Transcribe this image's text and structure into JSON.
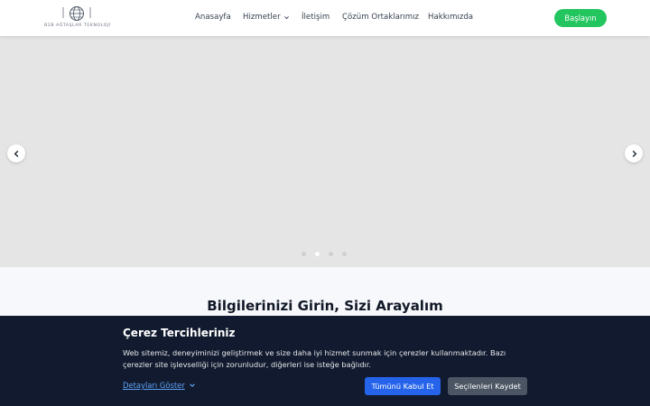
{
  "header": {
    "logo_text": "B2B AĞTAŞLAR TEKNOLOJİ",
    "nav": [
      {
        "label": "Anasayfa"
      },
      {
        "label": "Hizmetler",
        "has_dropdown": true
      },
      {
        "label": "İletişim"
      },
      {
        "label": "Çözüm Ortaklarımız"
      },
      {
        "label": "Hakkımızda"
      }
    ],
    "cta_label": "Başlayın"
  },
  "slider": {
    "prev_icon": "chevron-left-icon",
    "next_icon": "chevron-right-icon",
    "slide_count": 4,
    "active_slide": 2
  },
  "section": {
    "title": "Bilgilerinizi Girin, Sizi Arayalım"
  },
  "cookie_banner": {
    "title": "Çerez Tercihleriniz",
    "text": "Web sitemiz, deneyiminizi geliştirmek ve size daha iyi hizmet sunmak için çerezler kullanmaktadır. Bazı çerezler site işlevselliği için zorunludur, diğerleri ise isteğe bağlıdır.",
    "details_label": "Detayları Göster",
    "accept_all_label": "Tümünü Kabul Et",
    "save_selected_label": "Seçilenleri Kaydet"
  },
  "colors": {
    "cta": "#22c55e",
    "banner_bg": "#111a2e",
    "accept_button": "#2563eb",
    "save_button": "#4b5563",
    "link": "#60a5fa"
  }
}
